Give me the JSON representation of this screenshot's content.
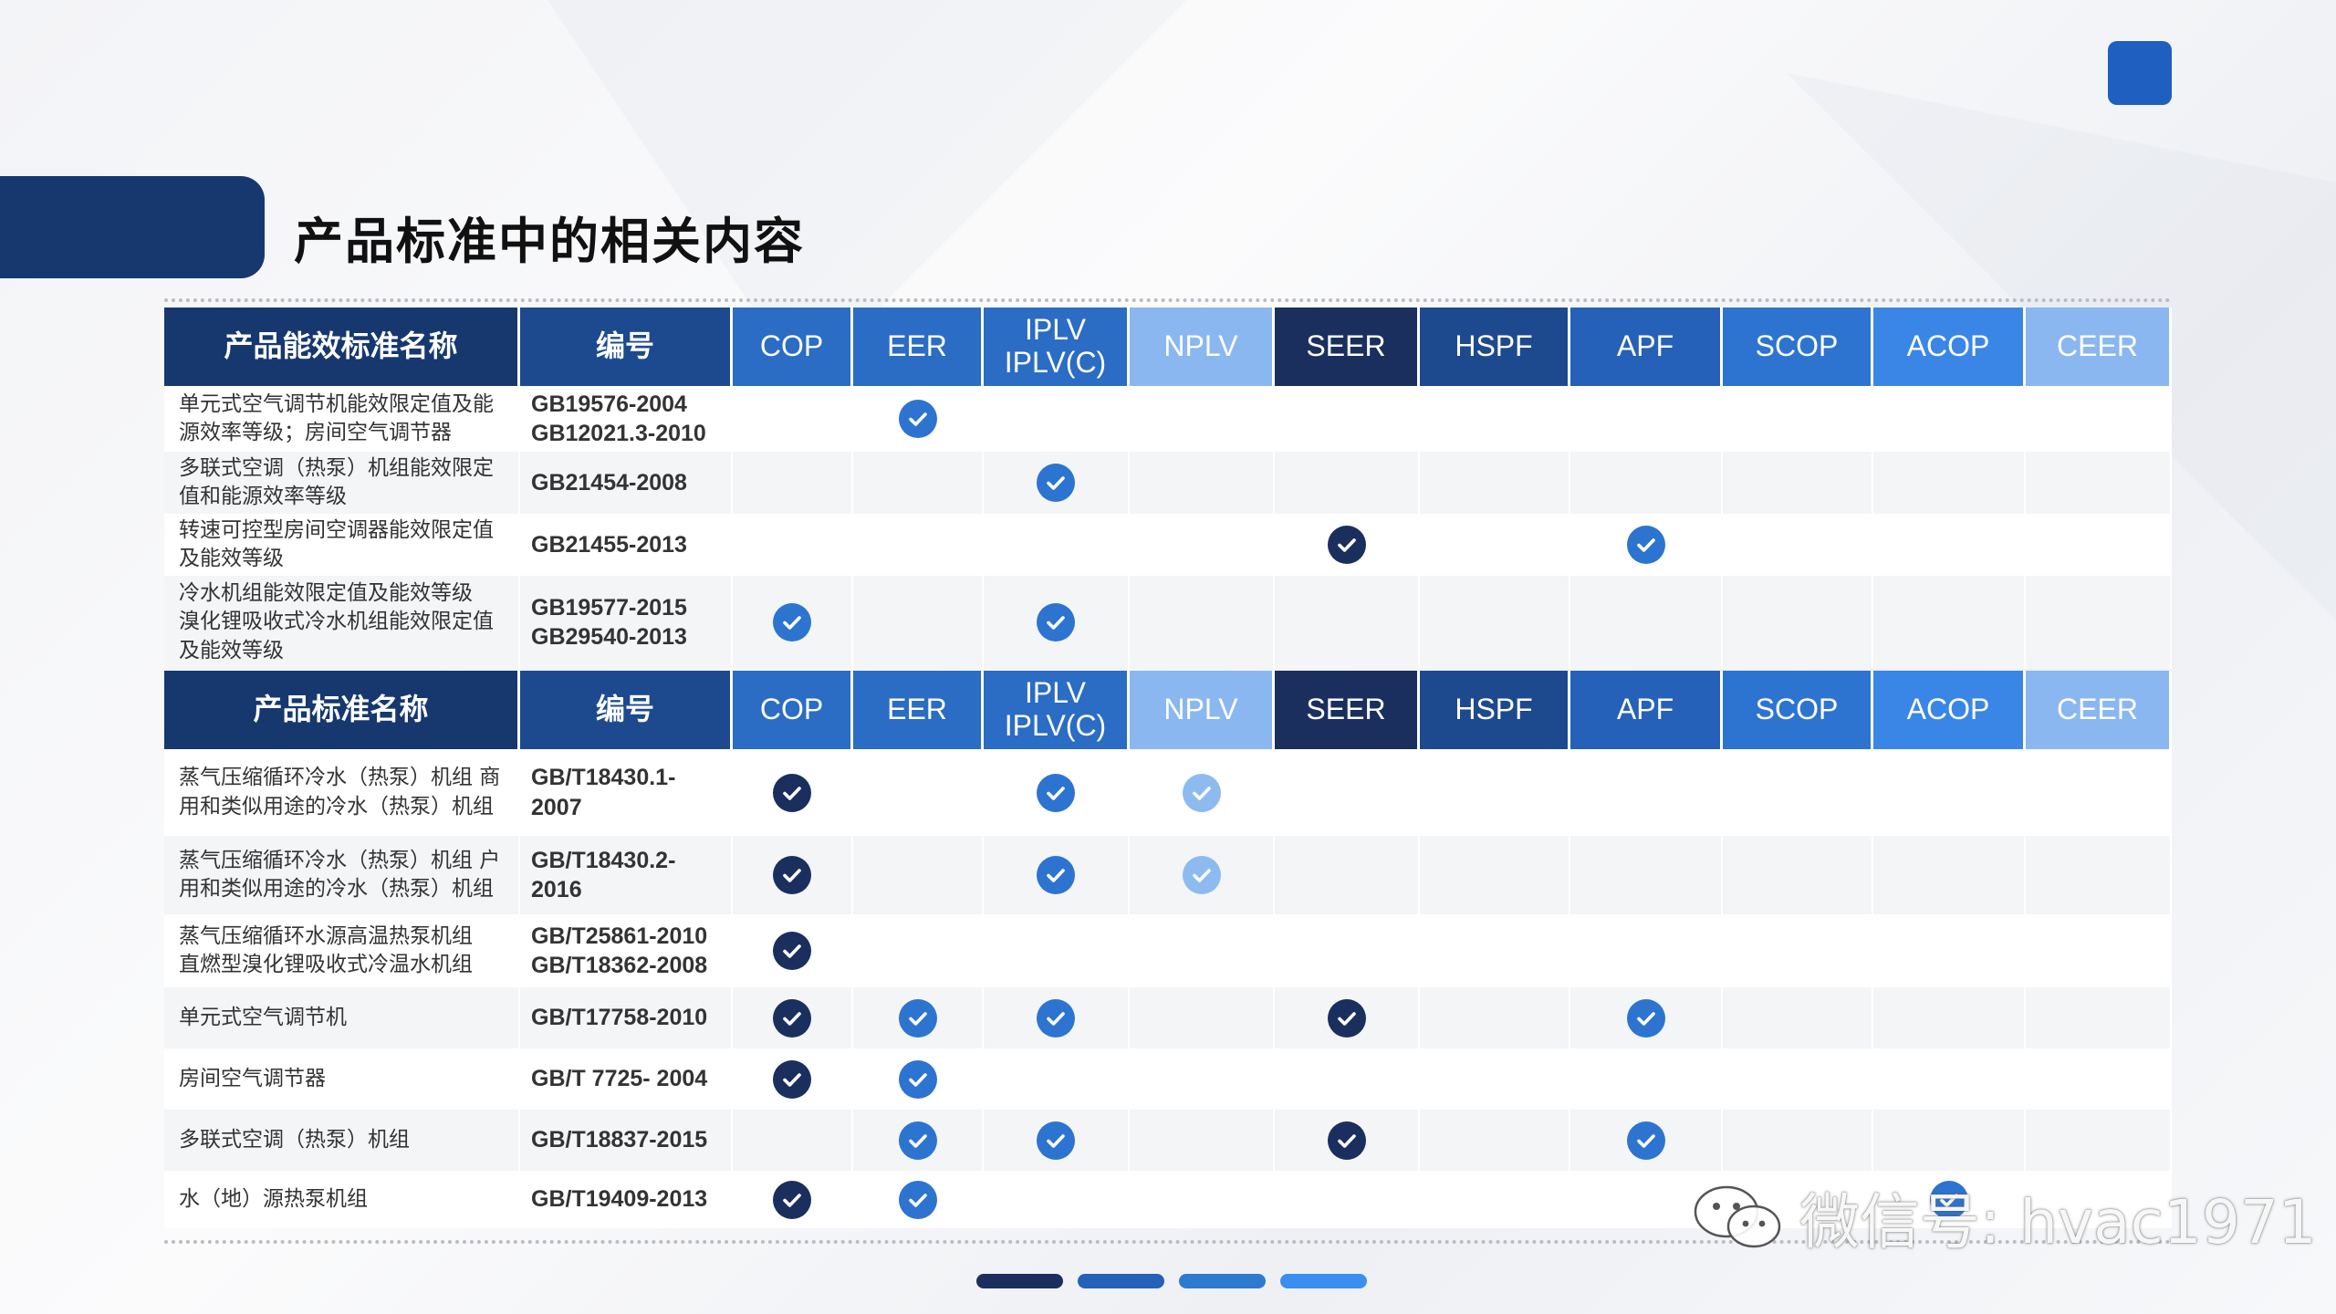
{
  "title": "产品标准中的相关内容",
  "watermark": "微信号: hvac1971",
  "colors": {
    "navy": "#16386f",
    "blue_mid": "#2b6cc4",
    "blue_light": "#8ab7ef",
    "check_navy": "#1a2f5e",
    "check_blue": "#2d74d0",
    "check_light": "#8dbbf0"
  },
  "table1": {
    "headers": [
      "产品能效标准名称",
      "编号",
      "COP",
      "EER",
      "IPLV\nIPLV(C)",
      "NPLV",
      "SEER",
      "HSPF",
      "APF",
      "SCOP",
      "ACOP",
      "CEER"
    ],
    "rows": [
      {
        "name": "单元式空气调节机能效限定值及能\n源效率等级；房间空气调节器",
        "code": "GB19576-2004\nGB12021.3-2010",
        "checks": [
          "",
          "blue",
          "",
          "",
          "",
          "",
          "",
          "",
          "",
          ""
        ]
      },
      {
        "name": "多联式空调（热泵）机组能效限定\n值和能源效率等级",
        "code": "GB21454-2008",
        "checks": [
          "",
          "",
          "blue",
          "",
          "",
          "",
          "",
          "",
          "",
          ""
        ]
      },
      {
        "name": "转速可控型房间空调器能效限定值\n及能效等级",
        "code": "GB21455-2013",
        "checks": [
          "",
          "",
          "",
          "",
          "navy",
          "",
          "blue",
          "",
          "",
          ""
        ]
      },
      {
        "name": "冷水机组能效限定值及能效等级\n溴化锂吸收式冷水机组能效限定值\n及能效等级",
        "code": "GB19577-2015\nGB29540-2013",
        "checks": [
          "blue",
          "",
          "blue",
          "",
          "",
          "",
          "",
          "",
          "",
          ""
        ]
      }
    ]
  },
  "table2": {
    "headers": [
      "产品标准名称",
      "编号",
      "COP",
      "EER",
      "IPLV\nIPLV(C)",
      "NPLV",
      "SEER",
      "HSPF",
      "APF",
      "SCOP",
      "ACOP",
      "CEER"
    ],
    "rows": [
      {
        "name": "蒸气压缩循环冷水（热泵）机组 商\n用和类似用途的冷水（热泵）机组",
        "code": "GB/T18430.1-\n2007",
        "checks": [
          "navy",
          "",
          "blue",
          "light",
          "",
          "",
          "",
          "",
          "",
          ""
        ]
      },
      {
        "name": "蒸气压缩循环冷水（热泵）机组 户\n用和类似用途的冷水（热泵）机组",
        "code": "GB/T18430.2-\n2016",
        "checks": [
          "navy",
          "",
          "blue",
          "light",
          "",
          "",
          "",
          "",
          "",
          ""
        ]
      },
      {
        "name": "蒸气压缩循环水源高温热泵机组\n直燃型溴化锂吸收式冷温水机组",
        "code": "GB/T25861-2010\nGB/T18362-2008",
        "checks": [
          "navy",
          "",
          "",
          "",
          "",
          "",
          "",
          "",
          "",
          ""
        ]
      },
      {
        "name": "单元式空气调节机",
        "code": "GB/T17758-2010",
        "checks": [
          "navy",
          "blue",
          "blue",
          "",
          "navy",
          "",
          "blue",
          "",
          "",
          ""
        ]
      },
      {
        "name": "房间空气调节器",
        "code": "GB/T 7725- 2004",
        "checks": [
          "navy",
          "blue",
          "",
          "",
          "",
          "",
          "",
          "",
          "",
          ""
        ]
      },
      {
        "name": "多联式空调（热泵）机组",
        "code": "GB/T18837-2015",
        "checks": [
          "",
          "blue",
          "blue",
          "",
          "navy",
          "",
          "blue",
          "",
          "",
          ""
        ]
      },
      {
        "name": "水（地）源热泵机组",
        "code": "GB/T19409-2013",
        "checks": [
          "navy",
          "blue",
          "",
          "",
          "",
          "",
          "",
          "",
          "blue",
          ""
        ]
      }
    ]
  }
}
